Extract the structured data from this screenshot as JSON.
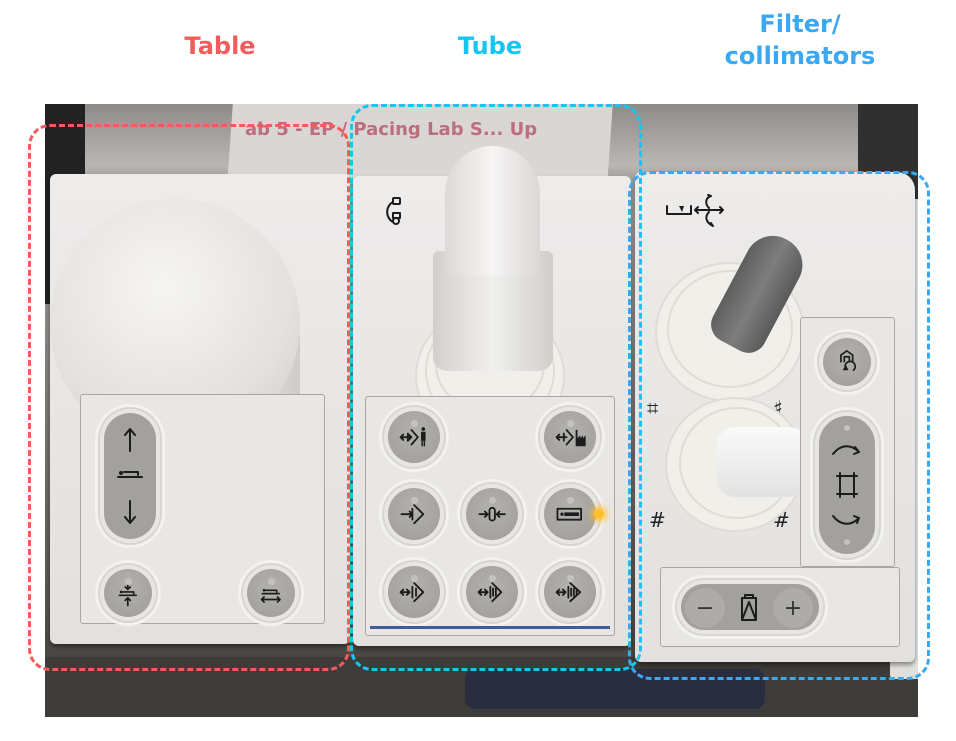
{
  "labels": {
    "table": "Table",
    "tube": "Tube",
    "filter": "Filter/\ncollimators"
  },
  "colors": {
    "table": "#f55b5b",
    "tube": "#16c6f2",
    "filter": "#3aa8f3",
    "status_led": "#ffc02b"
  },
  "background": {
    "paper_text": "ab 5 - EP / Pacing Lab S... Up"
  },
  "table_panel": {
    "controls": [
      {
        "id": "table-height",
        "icons": [
          "arrow-up-icon",
          "patient-table-icon",
          "arrow-down-icon"
        ],
        "type": "rocker"
      },
      {
        "id": "table-tilt",
        "icons": [
          "arrow-down-icon",
          "patient-table-icon",
          "arrow-up-icon"
        ],
        "type": "button"
      },
      {
        "id": "table-longitudinal",
        "icons": [
          "patient-table-icon",
          "arrow-left-right-icon"
        ],
        "type": "button"
      }
    ]
  },
  "tube_panel": {
    "joystick_icon": "c-arm-rotation-icon",
    "buttons": [
      {
        "id": "park-patient",
        "icon": "park-position-patient-icon"
      },
      {
        "id": "park-factory",
        "icon": "park-position-factory-icon"
      },
      {
        "id": "move-in",
        "icon": "move-to-position-icon"
      },
      {
        "id": "isocenter",
        "icon": "isocenter-icon"
      },
      {
        "id": "table-patient-position",
        "icon": "table-patient-icon",
        "led_active": true
      },
      {
        "id": "position-1",
        "icon": "stored-position-1-icon"
      },
      {
        "id": "position-2",
        "icon": "stored-position-2-icon"
      },
      {
        "id": "position-3",
        "icon": "stored-position-3-icon"
      }
    ]
  },
  "filter_panel": {
    "joystick_top_icon": "filter-wedge-move-rotate-icon",
    "joystick_bottom_icons": [
      "collimator-open-icon",
      "collimator-close-icon",
      "collimator-horizontal-icon",
      "collimator-vertical-icon"
    ],
    "side_buttons": [
      {
        "id": "home-reset",
        "icon": "home-reset-icon"
      },
      {
        "id": "rotate-cw",
        "icon": "rotate-clockwise-icon"
      },
      {
        "id": "rotate-ccw",
        "icon": "rotate-counterclockwise-icon"
      }
    ],
    "rocker": {
      "minus": "−",
      "plus": "+",
      "center_icon": "wedge-filter-icon"
    }
  }
}
